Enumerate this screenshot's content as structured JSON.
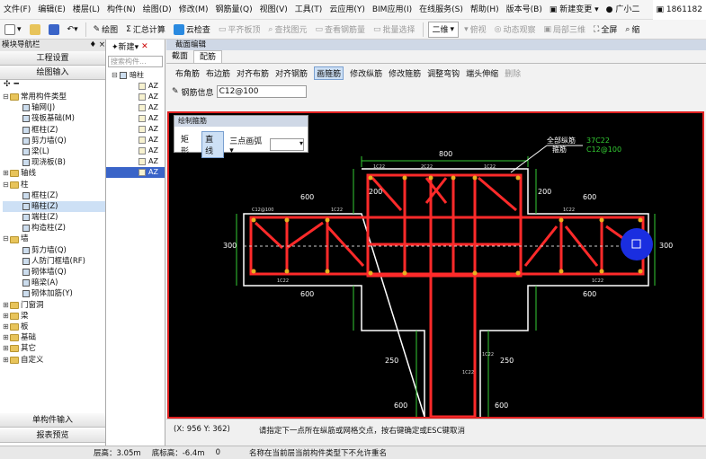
{
  "menubar": {
    "items": [
      "文件(F)",
      "编辑(E)",
      "楼层(L)",
      "构件(N)",
      "绘图(D)",
      "修改(M)",
      "钢筋量(Q)",
      "视图(V)",
      "工具(T)",
      "云应用(Y)",
      "BIM应用(I)",
      "在线服务(S)",
      "帮助(H)",
      "版本号(B)"
    ],
    "new_change": "新建变更",
    "user": "广小二",
    "phone": "1861182"
  },
  "toolbar": {
    "draw": "绘图",
    "sum_calc": "汇总计算",
    "cloud_check": "云检查",
    "level_board": "平齐板顶",
    "find_element": "查找图元",
    "view_rebar": "查看钢筋量",
    "batch_select": "批量选择",
    "view_mode": "二维",
    "top_view": "俯视",
    "dynamic_view": "动态观察",
    "local_3d": "局部三维",
    "full_screen": "全屏",
    "zoom": "缩"
  },
  "nav": {
    "title": "模块导航栏",
    "pin": "♦ ×",
    "btn_project": "工程设置",
    "btn_draw": "绘图输入",
    "tree": [
      {
        "level": 0,
        "label": "常用构件类型",
        "open": true
      },
      {
        "level": 1,
        "label": "轴网(J)"
      },
      {
        "level": 1,
        "label": "筏板基础(M)"
      },
      {
        "level": 1,
        "label": "框柱(Z)"
      },
      {
        "level": 1,
        "label": "剪力墙(Q)"
      },
      {
        "level": 1,
        "label": "梁(L)"
      },
      {
        "level": 1,
        "label": "现浇板(B)"
      },
      {
        "level": 0,
        "label": "轴线",
        "open": false
      },
      {
        "level": 0,
        "label": "柱",
        "open": true
      },
      {
        "level": 1,
        "label": "框柱(Z)"
      },
      {
        "level": 1,
        "label": "暗柱(Z)",
        "selected": true
      },
      {
        "level": 1,
        "label": "端柱(Z)"
      },
      {
        "level": 1,
        "label": "构造柱(Z)"
      },
      {
        "level": 0,
        "label": "墙",
        "open": true
      },
      {
        "level": 1,
        "label": "剪力墙(Q)"
      },
      {
        "level": 1,
        "label": "人防门框墙(RF)"
      },
      {
        "level": 1,
        "label": "砌体墙(Q)"
      },
      {
        "level": 1,
        "label": "暗梁(A)"
      },
      {
        "level": 1,
        "label": "砌体加筋(Y)"
      },
      {
        "level": 0,
        "label": "门窗洞",
        "open": false
      },
      {
        "level": 0,
        "label": "梁",
        "open": false
      },
      {
        "level": 0,
        "label": "板",
        "open": false
      },
      {
        "level": 0,
        "label": "基础",
        "open": false
      },
      {
        "level": 0,
        "label": "其它",
        "open": false
      },
      {
        "level": 0,
        "label": "自定义",
        "open": false
      }
    ],
    "btn_single": "单构件输入",
    "btn_report": "报表预览"
  },
  "mid": {
    "new_btn": "新建",
    "search_placeholder": "搜索构件...",
    "root": "暗柱",
    "items": [
      "AZ",
      "AZ",
      "AZ",
      "AZ",
      "AZ",
      "AZ",
      "AZ",
      "AZ",
      "AZ"
    ]
  },
  "editor": {
    "title": "截面编辑",
    "tabs": [
      "截面",
      "配筋"
    ],
    "active_tab": "配筋",
    "tools": [
      "布角筋",
      "布边筋",
      "对齐布筋",
      "对齐钢筋",
      "画箍筋",
      "修改纵筋",
      "修改箍筋",
      "调整弯钩",
      "端头伸缩",
      "删除"
    ],
    "rebar_info_label": "钢筋信息",
    "rebar_info_value": "C12@100",
    "draw_mode_title": "绘制箍筋",
    "draw_modes": [
      "矩形",
      "直线",
      "三点画弧"
    ]
  },
  "drawing": {
    "dims": {
      "top": "800",
      "left_top": "600",
      "right_top": "600",
      "left_h": "300",
      "right_h": "300",
      "left_bottom": "600",
      "right_bottom": "600",
      "mid_left": "200",
      "mid_right": "200",
      "lower_left": "250",
      "lower_right": "250",
      "foot_left": "600",
      "foot_right": "600"
    },
    "annot_label1": "全部纵筋",
    "annot_label2": "箍筋",
    "annot_value1": "37C22",
    "annot_value2": "C12@100",
    "small_labels": [
      "C12@100",
      "1C22",
      "1C22",
      "2C22",
      "1C22",
      "1C22",
      "1C22",
      "1C22",
      "1C22",
      "1C22"
    ]
  },
  "status": {
    "coords": "(X: 956 Y: 362)",
    "hint": "请指定下一点所在纵筋或网格交点，按右键确定或ESC键取消",
    "msg": "名称在当前层当前构件类型下不允许重名"
  },
  "bottom": {
    "floor_height": "层高：3.05m",
    "bottom_elev": "底标高：-6.4m",
    "value": "0"
  },
  "colors": {
    "rebar": "#ff2a2a",
    "concrete": "#ffffff",
    "dim": "#33cc33",
    "canvas": "#000000",
    "highlight": "#1a2ee0"
  }
}
